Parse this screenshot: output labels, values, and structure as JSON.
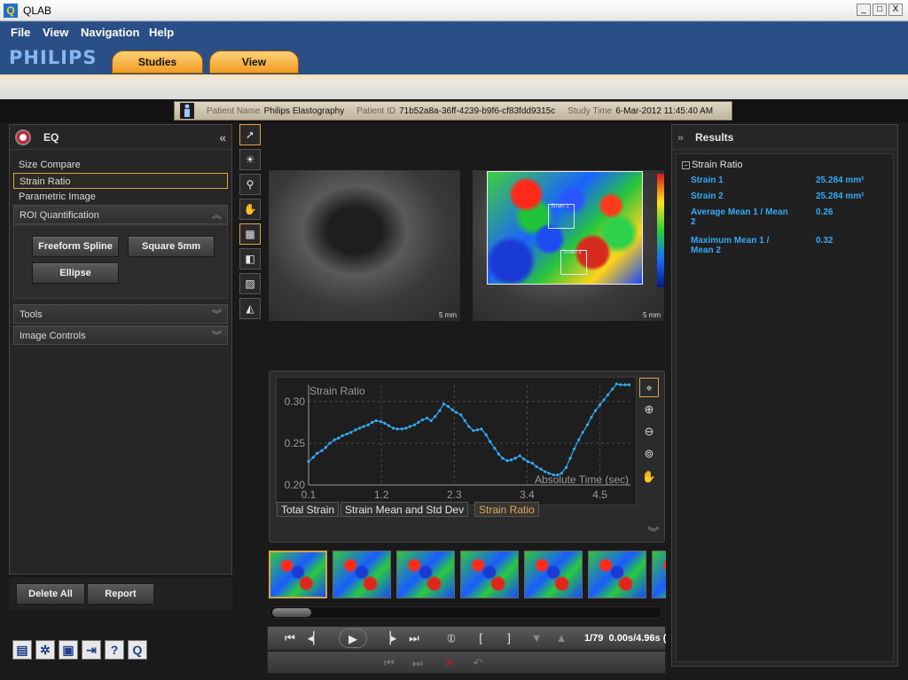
{
  "window": {
    "title": "QLAB",
    "app_icon": "Q",
    "min": "_",
    "max": "□",
    "close": "X"
  },
  "menu": {
    "file": "File",
    "view": "View",
    "navigation": "Navigation",
    "help": "Help"
  },
  "brand": "PHILIPS",
  "tabs": {
    "studies": "Studies",
    "view": "View"
  },
  "patient": {
    "name_label": "Patient Name",
    "name": "Philips Elastography",
    "id_label": "Patient ID",
    "id": "71b52a8a-36ff-4239-b9f6-cf83fdd9315c",
    "time_label": "Study Time",
    "time": "6-Mar-2012 11:45:40 AM"
  },
  "left_panel": {
    "title": "EQ",
    "collapse": "«",
    "items": [
      "Size Compare",
      "Strain Ratio",
      "Parametric Image"
    ],
    "selected_index": 1,
    "roi_section": "ROI Quantification",
    "roi_buttons": {
      "freeform": "Freeform Spline",
      "square": "Square 5mm",
      "ellipse": "Ellipse"
    },
    "tools_section": "Tools",
    "image_controls_section": "Image Controls",
    "chevron_up": "︽",
    "chevron_down": "︾",
    "delete_all": "Delete All",
    "report": "Report"
  },
  "bottom_icons": [
    "film-icon",
    "gears-icon",
    "save-icon",
    "exit-icon",
    "help-icon",
    "qlab-icon"
  ],
  "bottom_icon_glyphs": {
    "help": "?",
    "qlab": "Q"
  },
  "images": {
    "scale_left": "5 mm",
    "scale_right": "5 mm",
    "roi1": "Strain 1",
    "roi2": "Strain 2"
  },
  "chart_data": {
    "type": "line",
    "title": "Strain Ratio",
    "xlabel": "Absolute Time (sec)",
    "ylabel": "",
    "xticks": [
      "0.1",
      "1.2",
      "2.3",
      "3.4",
      "4.5"
    ],
    "yticks": [
      "0.20",
      "0.25",
      "0.30"
    ],
    "xlim": [
      0.1,
      4.96
    ],
    "ylim": [
      0.2,
      0.32
    ],
    "color": "#33aaf5",
    "x": [
      0.1,
      0.17,
      0.23,
      0.3,
      0.36,
      0.42,
      0.49,
      0.55,
      0.61,
      0.68,
      0.74,
      0.81,
      0.87,
      0.93,
      1.0,
      1.06,
      1.12,
      1.19,
      1.25,
      1.31,
      1.38,
      1.44,
      1.51,
      1.57,
      1.63,
      1.7,
      1.76,
      1.82,
      1.89,
      1.95,
      2.01,
      2.08,
      2.14,
      2.21,
      2.27,
      2.33,
      2.4,
      2.46,
      2.52,
      2.59,
      2.65,
      2.71,
      2.78,
      2.84,
      2.91,
      2.97,
      3.03,
      3.1,
      3.16,
      3.22,
      3.29,
      3.35,
      3.41,
      3.48,
      3.54,
      3.61,
      3.67,
      3.73,
      3.8,
      3.86,
      3.92,
      3.99,
      4.05,
      4.11,
      4.18,
      4.24,
      4.31,
      4.37,
      4.43,
      4.5,
      4.56,
      4.62,
      4.69,
      4.75,
      4.81,
      4.88,
      4.94
    ],
    "values": [
      0.228,
      0.233,
      0.238,
      0.241,
      0.245,
      0.25,
      0.254,
      0.256,
      0.259,
      0.261,
      0.263,
      0.266,
      0.268,
      0.27,
      0.272,
      0.275,
      0.277,
      0.276,
      0.274,
      0.271,
      0.268,
      0.267,
      0.267,
      0.268,
      0.27,
      0.272,
      0.275,
      0.278,
      0.28,
      0.277,
      0.282,
      0.289,
      0.297,
      0.294,
      0.29,
      0.287,
      0.284,
      0.277,
      0.27,
      0.265,
      0.266,
      0.267,
      0.26,
      0.252,
      0.244,
      0.237,
      0.232,
      0.229,
      0.23,
      0.232,
      0.235,
      0.231,
      0.228,
      0.226,
      0.222,
      0.219,
      0.216,
      0.214,
      0.212,
      0.212,
      0.214,
      0.221,
      0.232,
      0.243,
      0.254,
      0.263,
      0.272,
      0.281,
      0.289,
      0.296,
      0.302,
      0.308,
      0.315,
      0.321,
      0.32,
      0.32,
      0.32
    ]
  },
  "chart_tabs": [
    "Total Strain",
    "Strain Mean and Std Dev",
    "Strain Ratio"
  ],
  "chart_tab_active": 2,
  "zoom_tools": [
    "crosshair-icon",
    "zoom-in-icon",
    "zoom-out-icon",
    "zoom-reset-icon",
    "pan-hand-icon"
  ],
  "thumbnails": {
    "count": 7,
    "selected_index": 0
  },
  "playback": {
    "frame": "1/79",
    "time": "0.00s/4.96s (",
    "scroll_position": 0.0
  },
  "results": {
    "title": "Results",
    "expand": "»",
    "group": "Strain Ratio",
    "rows": [
      {
        "label": "Strain 1",
        "value": "25.284 mm²"
      },
      {
        "label": "Strain 2",
        "value": "25.284 mm²"
      },
      {
        "label": "Average Mean 1 / Mean 2",
        "value": "0.26"
      },
      {
        "label": "Maximum Mean 1 / Mean 2",
        "value": "0.32"
      }
    ]
  },
  "colors": {
    "accent": "#d9a44a",
    "result_text": "#33aaf5",
    "menu_bg": "#2a4e86",
    "brand": "#88b6f0"
  }
}
